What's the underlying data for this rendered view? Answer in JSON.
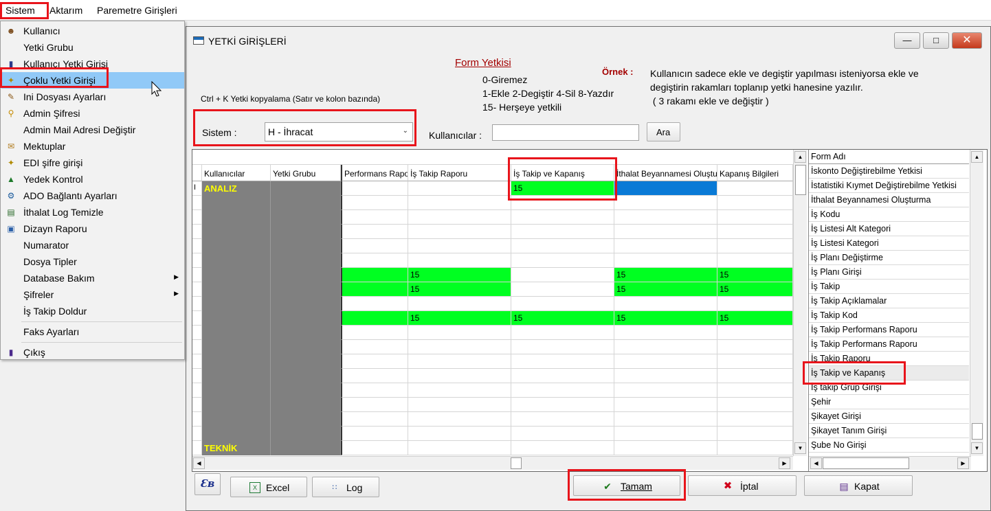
{
  "menubar": {
    "items": [
      "Sistem",
      "Aktarım",
      "Paremetre Girişleri"
    ]
  },
  "dropdown": {
    "items": [
      {
        "label": "Kullanıcı",
        "icon": "user-icon"
      },
      {
        "label": "Yetki Grubu",
        "icon": ""
      },
      {
        "label": "Kullanıcı Yetki Girişi",
        "icon": "user-key-icon"
      },
      {
        "label": "Çoklu Yetki Girişi",
        "icon": "keys-icon"
      },
      {
        "label": "Ini Dosyası  Ayarları",
        "icon": "file-settings-icon"
      },
      {
        "label": "Admin Şifresi",
        "icon": "key-icon"
      },
      {
        "label": "Admin Mail Adresi Değiştir",
        "icon": ""
      },
      {
        "label": "Mektuplar",
        "icon": "letter-icon"
      },
      {
        "label": "EDI şifre girişi",
        "icon": "keys-icon"
      },
      {
        "label": "Yedek Kontrol",
        "icon": "backup-icon"
      },
      {
        "label": "ADO Bağlantı Ayarları",
        "icon": "connection-icon"
      },
      {
        "label": "İthalat Log Temizle",
        "icon": "clean-icon"
      },
      {
        "label": "Dizayn Raporu",
        "icon": "report-icon"
      },
      {
        "label": "Numarator",
        "icon": ""
      },
      {
        "label": "Dosya Tipler",
        "icon": ""
      },
      {
        "label": "Database Bakım",
        "icon": ""
      },
      {
        "label": "Şifreler",
        "icon": ""
      },
      {
        "label": "İş Takip Doldur",
        "icon": ""
      },
      {
        "label": "Faks Ayarları",
        "icon": ""
      },
      {
        "label": "Çıkış",
        "icon": "exit-icon"
      }
    ]
  },
  "window": {
    "title": "YETKİ GİRİŞLERİ",
    "form_yetkisi_title": "Form Yetkisi",
    "legend_lines": [
      "0-Giremez",
      "1-Ekle  2-Degiştir  4-Sil  8-Yazdır",
      "15- Herşeye yetkili"
    ],
    "ornek_label": "Örnek :",
    "ornek_text": [
      "Kullanıcın sadece ekle ve degiştir yapılması isteniyorsa  ekle ve",
      "degiştirin rakamları toplanıp yetki hanesine yazılır.",
      " ( 3 rakamı ekle ve değiştir )"
    ],
    "copy_hint": "Ctrl + K Yetki kopyalama (Satır ve kolon bazında)",
    "sistem_label": "Sistem :",
    "sistem_value": "H - İhracat",
    "kullanicilar_label": "Kullanıcılar :",
    "kullanicilar_value": "",
    "ara_label": "Ara"
  },
  "grid": {
    "headers": [
      "Kullanıcılar",
      "Yetki Grubu",
      "Performans Raporu",
      "İş Takip Raporu",
      "İş Takip ve Kapanış",
      "İthalat Beyannamesi Oluşturma",
      "Kapanış Bilgileri"
    ],
    "rows": [
      {
        "user": "ANALIZ",
        "cells": [
          "",
          "",
          "15",
          "",
          ""
        ],
        "green": [
          false,
          false,
          true,
          false,
          false
        ],
        "blue": [
          false,
          false,
          false,
          true,
          false
        ]
      },
      {
        "user": "",
        "cells": [
          "",
          "",
          "",
          "",
          ""
        ]
      },
      {
        "user": "",
        "cells": [
          "",
          "",
          "",
          "",
          ""
        ]
      },
      {
        "user": "",
        "cells": [
          "",
          "",
          "",
          "",
          ""
        ]
      },
      {
        "user": "",
        "cells": [
          "",
          "",
          "",
          "",
          ""
        ]
      },
      {
        "user": "",
        "cells": [
          "",
          "",
          "",
          "",
          ""
        ]
      },
      {
        "user": "",
        "cells": [
          "",
          "15",
          "",
          "15",
          "15"
        ],
        "green": [
          true,
          true,
          false,
          true,
          true
        ]
      },
      {
        "user": "",
        "cells": [
          "",
          "15",
          "",
          "15",
          "15"
        ],
        "green": [
          true,
          true,
          false,
          true,
          true
        ]
      },
      {
        "user": "",
        "cells": [
          "",
          "",
          "",
          "",
          ""
        ]
      },
      {
        "user": "",
        "cells": [
          "",
          "15",
          "15",
          "15",
          "15"
        ],
        "green": [
          true,
          true,
          true,
          true,
          true
        ]
      },
      {
        "user": "",
        "cells": [
          "",
          "",
          "",
          "",
          ""
        ]
      },
      {
        "user": "",
        "cells": [
          "",
          "",
          "",
          "",
          ""
        ]
      },
      {
        "user": "",
        "cells": [
          "",
          "",
          "",
          "",
          ""
        ]
      },
      {
        "user": "",
        "cells": [
          "",
          "",
          "",
          "",
          ""
        ]
      },
      {
        "user": "",
        "cells": [
          "",
          "",
          "",
          "",
          ""
        ]
      },
      {
        "user": "",
        "cells": [
          "",
          "",
          "",
          "",
          ""
        ]
      },
      {
        "user": "",
        "cells": [
          "",
          "",
          "",
          "",
          ""
        ]
      },
      {
        "user": "",
        "cells": [
          "",
          "",
          "",
          "",
          ""
        ]
      },
      {
        "user": "TEKNİK",
        "cells": [
          "",
          "",
          "",
          "",
          ""
        ]
      }
    ]
  },
  "form_list": {
    "header": "Form Adı",
    "items": [
      "İskonto Değiştirebilme Yetkisi",
      "İstatistiki Kıymet Değiştirebilme Yetkisi",
      "İthalat Beyannamesi Oluşturma",
      "İş Kodu",
      "İş Listesi Alt Kategori",
      "İş Listesi Kategori",
      "İş Planı Değiştirme",
      "İş Planı Girişi",
      "İş Takip",
      "İş Takip Açıklamalar",
      "İş Takip Kod",
      "İş Takip Performans Raporu",
      "İş Takip Performans Raporu",
      "İş Takip Raporu",
      "İş Takip ve Kapanış",
      "İş takip Grup Girişi",
      "Şehir",
      "Şikayet Girişi",
      "Şikayet Tanım Girişi",
      "Şube No Girişi"
    ]
  },
  "buttons": {
    "excel": "Excel",
    "log": "Log",
    "tamam": "Tamam",
    "iptal": "İptal",
    "kapat": "Kapat"
  },
  "colors": {
    "green": "#00ff21",
    "blue": "#0a7ad6",
    "gray": "#808080",
    "yellow_text": "#ffff00",
    "highlight_red": "#e8141b",
    "menu_selected": "#91c9f7"
  }
}
